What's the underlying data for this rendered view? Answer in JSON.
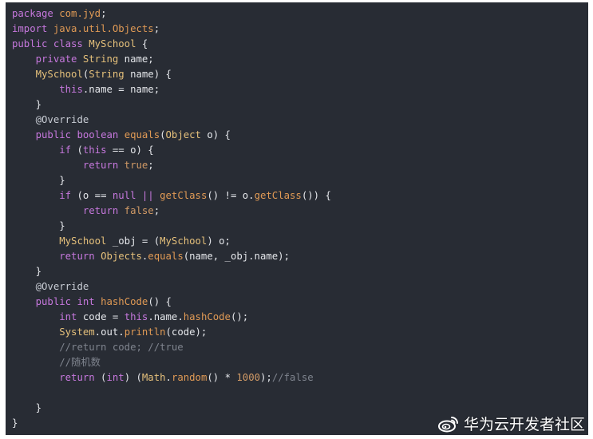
{
  "colors": {
    "background": "#282c34",
    "keyword": "#c678dd",
    "type": "#e5c07b",
    "function": "#e09a55",
    "literal": "#d19a66",
    "identifier": "#e5e7eb",
    "comment": "#7f848e"
  },
  "code_lines": [
    [
      [
        "kw",
        "package"
      ],
      [
        "sp",
        " "
      ],
      [
        "pkg",
        "com.jyd"
      ],
      [
        "punct",
        ";"
      ]
    ],
    [
      [
        "kw",
        "import"
      ],
      [
        "sp",
        " "
      ],
      [
        "pkg",
        "java.util.Objects"
      ],
      [
        "punct",
        ";"
      ]
    ],
    [
      [
        "kw",
        "public class"
      ],
      [
        "sp",
        " "
      ],
      [
        "type",
        "MySchool"
      ],
      [
        "punct",
        " {"
      ]
    ],
    [
      [
        "sp",
        "    "
      ],
      [
        "kw",
        "private"
      ],
      [
        "sp",
        " "
      ],
      [
        "type",
        "String"
      ],
      [
        "id",
        " name;"
      ]
    ],
    [
      [
        "sp",
        "    "
      ],
      [
        "type",
        "MySchool"
      ],
      [
        "punct",
        "("
      ],
      [
        "type",
        "String"
      ],
      [
        "id",
        " name) {"
      ]
    ],
    [
      [
        "sp",
        "        "
      ],
      [
        "kw",
        "this"
      ],
      [
        "id",
        ".name = name;"
      ]
    ],
    [
      [
        "sp",
        "    "
      ],
      [
        "punct",
        "}"
      ]
    ],
    [
      [
        "sp",
        "    "
      ],
      [
        "anno",
        "@Override"
      ]
    ],
    [
      [
        "sp",
        "    "
      ],
      [
        "kw",
        "public"
      ],
      [
        "sp",
        " "
      ],
      [
        "kw",
        "boolean"
      ],
      [
        "sp",
        " "
      ],
      [
        "fn",
        "equals"
      ],
      [
        "punct",
        "("
      ],
      [
        "type",
        "Object"
      ],
      [
        "id",
        " o) {"
      ]
    ],
    [
      [
        "sp",
        "        "
      ],
      [
        "kw",
        "if"
      ],
      [
        "id",
        " ("
      ],
      [
        "kw",
        "this"
      ],
      [
        "id",
        " == o) {"
      ]
    ],
    [
      [
        "sp",
        "            "
      ],
      [
        "kw",
        "return"
      ],
      [
        "sp",
        " "
      ],
      [
        "lit",
        "true"
      ],
      [
        "punct",
        ";"
      ]
    ],
    [
      [
        "sp",
        "        "
      ],
      [
        "punct",
        "}"
      ]
    ],
    [
      [
        "sp",
        "        "
      ],
      [
        "kw",
        "if"
      ],
      [
        "id",
        " (o == "
      ],
      [
        "kw",
        "null"
      ],
      [
        "sp",
        " "
      ],
      [
        "op",
        "||"
      ],
      [
        "sp",
        " "
      ],
      [
        "fn",
        "getClass"
      ],
      [
        "id",
        "() != o."
      ],
      [
        "fn",
        "getClass"
      ],
      [
        "id",
        "()) {"
      ]
    ],
    [
      [
        "sp",
        "            "
      ],
      [
        "kw",
        "return"
      ],
      [
        "sp",
        " "
      ],
      [
        "lit",
        "false"
      ],
      [
        "punct",
        ";"
      ]
    ],
    [
      [
        "sp",
        "        "
      ],
      [
        "punct",
        "}"
      ]
    ],
    [
      [
        "sp",
        "        "
      ],
      [
        "type",
        "MySchool"
      ],
      [
        "id",
        " _obj = ("
      ],
      [
        "type",
        "MySchool"
      ],
      [
        "id",
        ") o;"
      ]
    ],
    [
      [
        "sp",
        "        "
      ],
      [
        "kw",
        "return"
      ],
      [
        "sp",
        " "
      ],
      [
        "type",
        "Objects"
      ],
      [
        "punct",
        "."
      ],
      [
        "fn",
        "equals"
      ],
      [
        "id",
        "(name, _obj.name);"
      ]
    ],
    [
      [
        "sp",
        "    "
      ],
      [
        "punct",
        "}"
      ]
    ],
    [
      [
        "sp",
        "    "
      ],
      [
        "anno",
        "@Override"
      ]
    ],
    [
      [
        "sp",
        "    "
      ],
      [
        "kw",
        "public"
      ],
      [
        "sp",
        " "
      ],
      [
        "kw",
        "int"
      ],
      [
        "sp",
        " "
      ],
      [
        "fn",
        "hashCode"
      ],
      [
        "punct",
        "() {"
      ]
    ],
    [
      [
        "sp",
        "        "
      ],
      [
        "kw",
        "int"
      ],
      [
        "id",
        " code = "
      ],
      [
        "kw",
        "this"
      ],
      [
        "id",
        ".name."
      ],
      [
        "fn",
        "hashCode"
      ],
      [
        "punct",
        "();"
      ]
    ],
    [
      [
        "sp",
        "        "
      ],
      [
        "type",
        "System"
      ],
      [
        "punct",
        "."
      ],
      [
        "id",
        "out"
      ],
      [
        "punct",
        "."
      ],
      [
        "fn",
        "println"
      ],
      [
        "id",
        "(code);"
      ]
    ],
    [
      [
        "sp",
        "        "
      ],
      [
        "cmt",
        "//return code; //true"
      ]
    ],
    [
      [
        "sp",
        "        "
      ],
      [
        "cmt",
        "//随机数"
      ]
    ],
    [
      [
        "sp",
        "        "
      ],
      [
        "kw",
        "return"
      ],
      [
        "id",
        " ("
      ],
      [
        "kw",
        "int"
      ],
      [
        "id",
        ") ("
      ],
      [
        "type",
        "Math"
      ],
      [
        "punct",
        "."
      ],
      [
        "fn",
        "random"
      ],
      [
        "id",
        "() * "
      ],
      [
        "lit",
        "1000"
      ],
      [
        "id",
        ");"
      ],
      [
        "cmt",
        "//false"
      ]
    ],
    [
      [
        "sp",
        ""
      ]
    ],
    [
      [
        "sp",
        "    "
      ],
      [
        "punct",
        "}"
      ]
    ],
    [
      [
        "punct",
        "}"
      ]
    ]
  ],
  "watermark": {
    "icon": "weibo-icon",
    "text": "华为云开发者社区"
  }
}
